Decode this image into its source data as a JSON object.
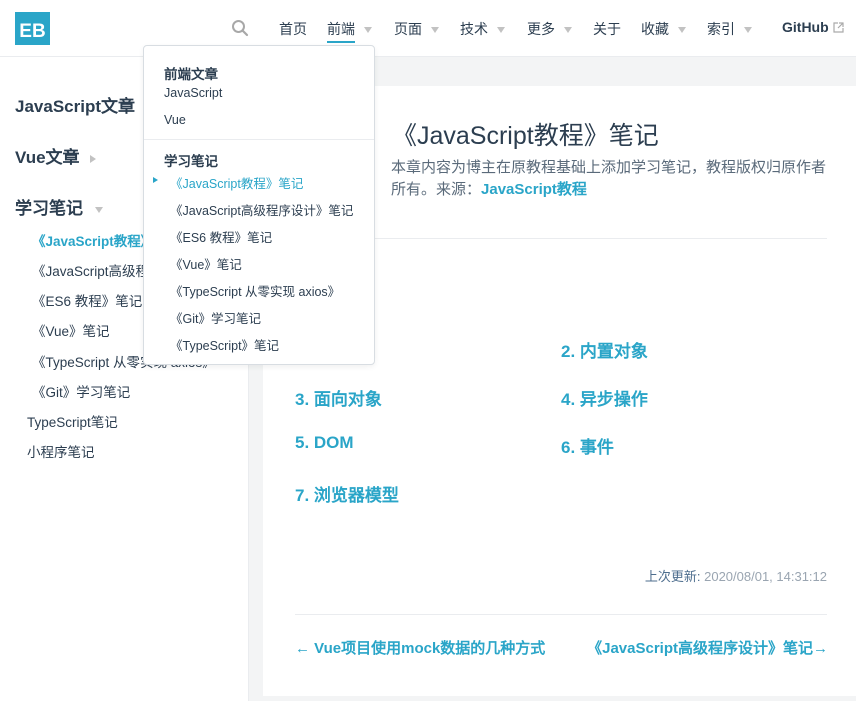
{
  "brand": {
    "logo_text": "EB",
    "accent": "#2aa5c8"
  },
  "nav": {
    "items": [
      {
        "label": "首页",
        "caret": false
      },
      {
        "label": "前端",
        "caret": true
      },
      {
        "label": "页面",
        "caret": true
      },
      {
        "label": "技术",
        "caret": true
      },
      {
        "label": "更多",
        "caret": true
      },
      {
        "label": "关于",
        "caret": false
      },
      {
        "label": "收藏",
        "caret": true
      },
      {
        "label": "索引",
        "caret": true
      },
      {
        "label": "GitHub",
        "caret": false,
        "external": true
      }
    ],
    "search_icon": "search-icon"
  },
  "dropdown": {
    "group1": {
      "title": "前端文章",
      "items": [
        "JavaScript",
        "Vue"
      ]
    },
    "group2": {
      "title": "学习笔记",
      "items": [
        "《JavaScript教程》笔记",
        "《JavaScript高级程序设计》笔记",
        "《ES6 教程》笔记",
        "《Vue》笔记",
        "《TypeScript 从零实现 axios》",
        "《Git》学习笔记",
        "《TypeScript》笔记"
      ]
    }
  },
  "sidebar": {
    "groups": [
      "JavaScript文章",
      "Vue文章",
      "学习笔记"
    ],
    "links": [
      "《JavaScript教程》笔记",
      "《JavaScript高级程序设计》笔记",
      "《ES6 教程》笔记",
      "《Vue》笔记",
      "《TypeScript 从零实现 axios》",
      "《Git》学习笔记"
    ],
    "extra": [
      "TypeScript笔记",
      "小程序笔记"
    ]
  },
  "page": {
    "title": "《JavaScript教程》笔记",
    "intro": "本章内容为博主在原教程基础上添加学习笔记，教程版权归原作者所有。来源：",
    "intro_link": "JavaScript教程",
    "toc": [
      "2. 内置对象",
      "3. 面向对象",
      "4. 异步操作",
      "5. DOM",
      "6. 事件",
      "7. 浏览器模型"
    ],
    "last_updated_label": "上次更新:",
    "last_updated_time": "2020/08/01, 14:31:12",
    "prev": "← Vue项目使用mock数据的几种方式",
    "next": "《JavaScript高级程序设计》笔记→"
  }
}
